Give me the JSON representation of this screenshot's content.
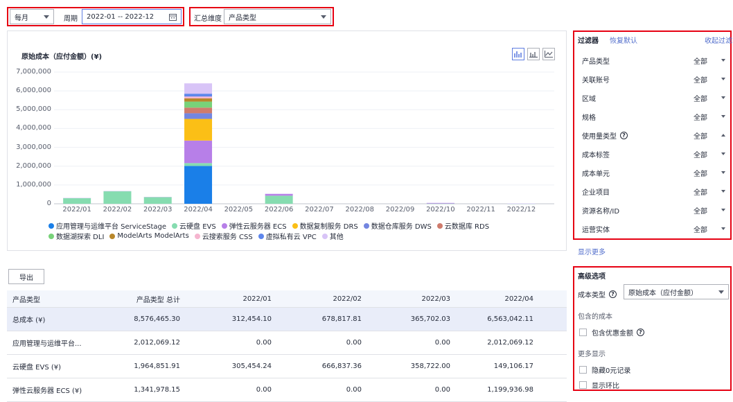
{
  "toolbar": {
    "granularity": "每月",
    "period_label": "周期",
    "period_value": "2022-01 -- 2022-12",
    "dimension_label": "汇总维度",
    "dimension_value": "产品类型"
  },
  "chart": {
    "title": "原始成本（应付金额）(¥)",
    "y_ticks": [
      "7,000,000",
      "6,000,000",
      "5,000,000",
      "4,000,000",
      "3,000,000",
      "2,000,000",
      "1,000,000",
      "0"
    ],
    "x_ticks": [
      "2022/01",
      "2022/02",
      "2022/03",
      "2022/04",
      "2022/05",
      "2022/06",
      "2022/07",
      "2022/08",
      "2022/09",
      "2022/10",
      "2022/11",
      "2022/12"
    ],
    "legend": [
      {
        "name": "应用管理与运维平台 ServiceStage",
        "color": "#1a7fe8"
      },
      {
        "name": "云硬盘 EVS",
        "color": "#86dcb0"
      },
      {
        "name": "弹性云服务器 ECS",
        "color": "#b77fe8"
      },
      {
        "name": "数据复制服务 DRS",
        "color": "#fbbf16"
      },
      {
        "name": "数据仓库服务 DWS",
        "color": "#7386e0"
      },
      {
        "name": "云数据库 RDS",
        "color": "#cf7b6c"
      },
      {
        "name": "数据湖探索 DLI",
        "color": "#78d279"
      },
      {
        "name": "ModelArts ModelArts",
        "color": "#b8872a"
      },
      {
        "name": "云搜索服务 CSS",
        "color": "#f5b5cf"
      },
      {
        "name": "虚拟私有云 VPC",
        "color": "#5e86ec"
      },
      {
        "name": "其他",
        "color": "#d8c4f7"
      }
    ]
  },
  "chart_data": {
    "type": "bar",
    "stacked": true,
    "categories": [
      "2022/01",
      "2022/02",
      "2022/03",
      "2022/04",
      "2022/05",
      "2022/06",
      "2022/07",
      "2022/08",
      "2022/09",
      "2022/10",
      "2022/11",
      "2022/12"
    ],
    "ylim": [
      0,
      7000000
    ],
    "series": [
      {
        "name": "应用管理与运维平台 ServiceStage",
        "values": [
          0,
          0,
          0,
          2012069.12,
          0,
          0,
          0,
          0,
          0,
          0,
          0,
          0
        ]
      },
      {
        "name": "云硬盘 EVS",
        "values": [
          305454.24,
          666837.36,
          358722.0,
          149106.17,
          0,
          430000,
          0,
          0,
          0,
          10000,
          0,
          5000
        ]
      },
      {
        "name": "弹性云服务器 ECS",
        "values": [
          0,
          0,
          0,
          1199936.98,
          0,
          90000,
          0,
          0,
          0,
          30000,
          0,
          8000
        ]
      },
      {
        "name": "数据复制服务 DRS",
        "values": [
          0,
          0,
          0,
          1150000,
          0,
          0,
          0,
          0,
          0,
          0,
          0,
          0
        ]
      },
      {
        "name": "数据仓库服务 DWS",
        "values": [
          0,
          0,
          0,
          300000,
          0,
          0,
          0,
          0,
          0,
          0,
          0,
          0
        ]
      },
      {
        "name": "云数据库 RDS",
        "values": [
          0,
          0,
          0,
          300000,
          0,
          0,
          0,
          0,
          0,
          0,
          0,
          0
        ]
      },
      {
        "name": "数据湖探索 DLI",
        "values": [
          0,
          0,
          0,
          320000,
          0,
          0,
          0,
          0,
          0,
          0,
          0,
          0
        ]
      },
      {
        "name": "ModelArts ModelArts",
        "values": [
          0,
          0,
          0,
          170000,
          0,
          0,
          0,
          0,
          0,
          0,
          0,
          0
        ]
      },
      {
        "name": "云搜索服务 CSS",
        "values": [
          0,
          0,
          0,
          100000,
          0,
          0,
          0,
          0,
          0,
          0,
          0,
          0
        ]
      },
      {
        "name": "虚拟私有云 VPC",
        "values": [
          0,
          0,
          0,
          150000,
          0,
          0,
          0,
          0,
          0,
          0,
          0,
          0
        ]
      },
      {
        "name": "其他",
        "values": [
          7000,
          12000,
          7000,
          550000,
          0,
          20000,
          0,
          0,
          0,
          10000,
          0,
          5000
        ]
      }
    ]
  },
  "table": {
    "export_label": "导出",
    "columns": [
      "产品类型",
      "产品类型 总计",
      "2022/01",
      "2022/02",
      "2022/03",
      "2022/04"
    ],
    "rows": [
      [
        "总成本 (¥)",
        "8,576,465.30",
        "312,454.10",
        "678,817.81",
        "365,702.03",
        "6,563,042.11"
      ],
      [
        "应用管理与运维平台...",
        "2,012,069.12",
        "0.00",
        "0.00",
        "0.00",
        "2,012,069.12"
      ],
      [
        "云硬盘 EVS (¥)",
        "1,964,851.91",
        "305,454.24",
        "666,837.36",
        "358,722.00",
        "149,106.17"
      ],
      [
        "弹性云服务器 ECS (¥)",
        "1,341,978.15",
        "0.00",
        "0.00",
        "0.00",
        "1,199,936.98"
      ]
    ]
  },
  "filters": {
    "title": "过滤器",
    "reset": "恢复默认",
    "collapse": "收起过滤",
    "items": [
      {
        "label": "产品类型",
        "value": "全部"
      },
      {
        "label": "关联账号",
        "value": "全部"
      },
      {
        "label": "区域",
        "value": "全部"
      },
      {
        "label": "规格",
        "value": "全部"
      },
      {
        "label": "使用量类型",
        "value": "全部"
      },
      {
        "label": "成本标签",
        "value": "全部"
      },
      {
        "label": "成本单元",
        "value": "全部"
      },
      {
        "label": "企业项目",
        "value": "全部"
      },
      {
        "label": "资源名称/ID",
        "value": "全部"
      },
      {
        "label": "运营实体",
        "value": "全部"
      }
    ],
    "show_more": "显示更多"
  },
  "advanced": {
    "title": "高级选项",
    "cost_type_label": "成本类型",
    "cost_type_value": "原始成本（应付金额）",
    "included_cost": "包含的成本",
    "include_discount": "包含优惠金额",
    "more_display": "更多显示",
    "hide_zero": "隐藏0元记录",
    "show_ratio": "显示环比"
  },
  "colors": {
    "accent": "#526ecc",
    "highlight": "#e60012"
  }
}
